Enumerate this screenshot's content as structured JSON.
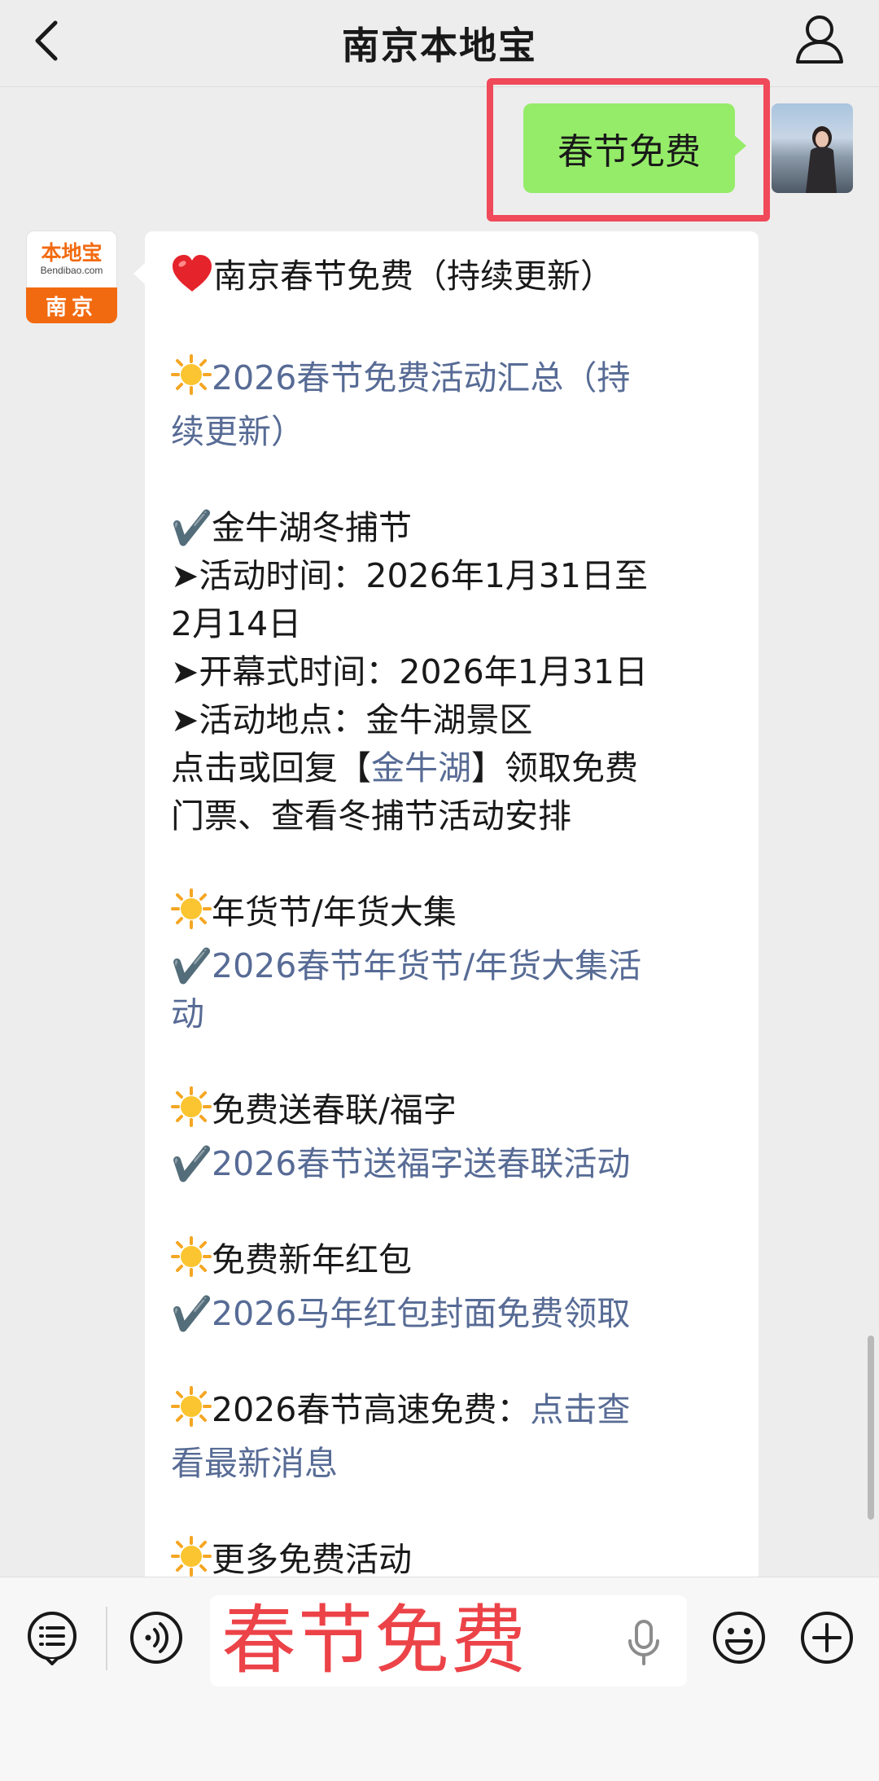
{
  "header": {
    "title": "南京本地宝",
    "back_icon": "chevron-left-icon",
    "profile_icon": "person-icon"
  },
  "sent_message": {
    "text": "春节免费",
    "highlight_color": "#f0495a",
    "bubble_color": "#95ec69"
  },
  "bot": {
    "avatar_logo": "本地宝",
    "avatar_sub": "Bendibao.com",
    "avatar_city": "南京"
  },
  "reply": {
    "title": "南京春节免费（持续更新）",
    "summary_link": [
      "2026春节免费活动汇总（持",
      "续更新）"
    ],
    "jinniuhu": {
      "name": "金牛湖冬捕节",
      "lines": [
        "➤活动时间：2026年1月31日至",
        "2月14日",
        "➤开幕式时间：2026年1月31日",
        "➤活动地点：金牛湖景区"
      ],
      "reply_prefix": "点击或回复【",
      "reply_link": "金牛湖",
      "reply_suffix": "】领取免费",
      "reply_line2": "门票、查看冬捕节活动安排"
    },
    "sections": [
      {
        "heading": "年货节/年货大集",
        "link_lines": [
          "2026春节年货节/年货大集活",
          "动"
        ]
      },
      {
        "heading": "免费送春联/福字",
        "link_lines": [
          "2026春节送福字送春联活动"
        ]
      },
      {
        "heading": "免费新年红包",
        "link_lines": [
          "2026马年红包封面免费领取"
        ]
      }
    ],
    "highway": {
      "prefix": "2026春节高速免费：",
      "link_part1": "点击查",
      "link_part2": "看最新消息"
    },
    "more": "更多免费活动",
    "link_color": "#576b95"
  },
  "input_bar": {
    "field_text": "春节免费",
    "field_text_color": "#ec4348",
    "icons": [
      "menu-list-icon",
      "voice-icon",
      "microphone-icon",
      "emoji-icon",
      "plus-icon"
    ]
  }
}
